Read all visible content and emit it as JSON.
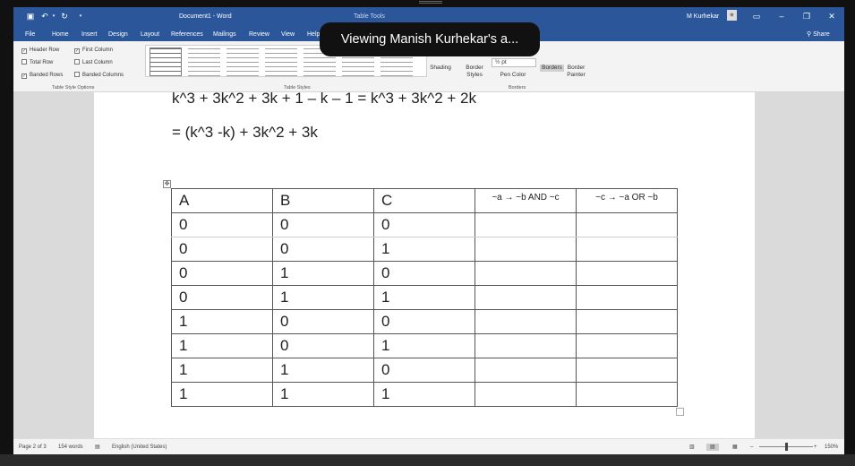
{
  "titlebar": {
    "document_title": "Document1 - Word",
    "contextual_tab": "Table Tools",
    "user_name": "M Kurhekar",
    "icons": [
      "save-icon",
      "undo-icon",
      "redo-icon",
      "customize-icon",
      "ribbon-display-icon",
      "minimize-icon",
      "restore-icon",
      "close-icon"
    ]
  },
  "tabs": [
    "File",
    "Home",
    "Insert",
    "Design",
    "Layout",
    "References",
    "Mailings",
    "Review",
    "View",
    "Help"
  ],
  "share_label": "Share",
  "ribbon": {
    "table_style_options": {
      "items": [
        {
          "label": "Header Row",
          "checked": true
        },
        {
          "label": "First Column",
          "checked": true
        },
        {
          "label": "Total Row",
          "checked": false
        },
        {
          "label": "Last Column",
          "checked": false
        },
        {
          "label": "Banded Rows",
          "checked": true
        },
        {
          "label": "Banded Columns",
          "checked": false
        }
      ],
      "group_label": "Table Style Options"
    },
    "table_styles_label": "Table Styles",
    "shading_label": "Shading",
    "border_styles_label": "Border Styles",
    "pen_weight": "½ pt",
    "pen_color_label": "Pen Color",
    "borders_label": "Borders",
    "border_painter_label": "Border Painter",
    "borders_group_label": "Borders"
  },
  "document": {
    "line1": "k^3 + 3k^2 + 3k + 1 – k – 1 = k^3 + 3k^2 + 2k",
    "line2": "= (k^3 -k) + 3k^2 + 3k",
    "table": {
      "headers": [
        "A",
        "B",
        "C",
        "~a → ~b AND ~c",
        "~c → ~a OR ~b"
      ],
      "rows": [
        [
          "0",
          "0",
          "0",
          "",
          ""
        ],
        [
          "0",
          "0",
          "1",
          "",
          ""
        ],
        [
          "0",
          "1",
          "0",
          "",
          ""
        ],
        [
          "0",
          "1",
          "1",
          "",
          ""
        ],
        [
          "1",
          "0",
          "0",
          "",
          ""
        ],
        [
          "1",
          "0",
          "1",
          "",
          ""
        ],
        [
          "1",
          "1",
          "0",
          "",
          ""
        ],
        [
          "1",
          "1",
          "1",
          "",
          ""
        ]
      ]
    }
  },
  "status": {
    "page": "Page 2 of 3",
    "words": "154 words",
    "language": "English (United States)",
    "zoom": "150%"
  },
  "toast": "Viewing Manish Kurhekar's a..."
}
